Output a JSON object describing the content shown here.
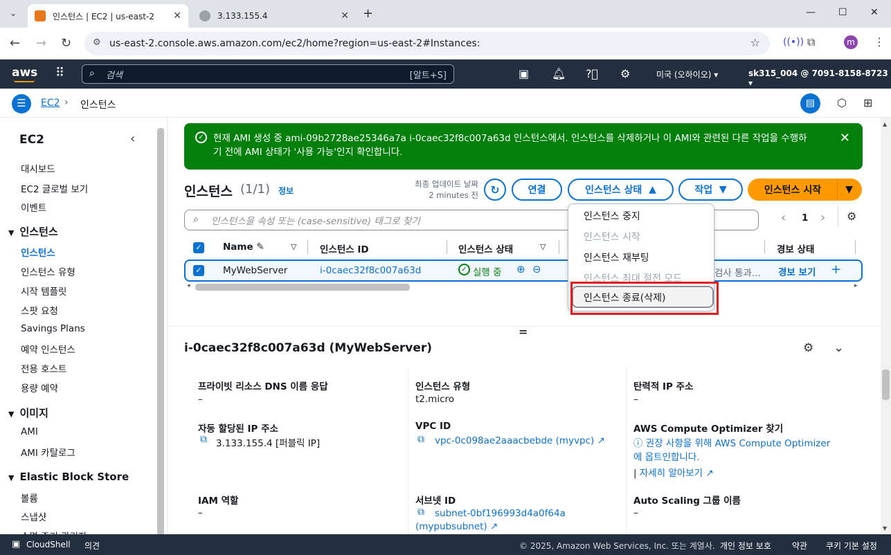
{
  "browser": {
    "tabs": [
      {
        "title": "인스턴스 | EC2 | us-east-2"
      },
      {
        "title": "3.133.155.4"
      }
    ],
    "url": "us-east-2.console.aws.amazon.com/ec2/home?region=us-east-2#Instances:",
    "profile_initial": "m"
  },
  "aws_nav": {
    "logo": "aws",
    "search_placeholder": "검색",
    "search_shortcut": "[알트+S]",
    "region": "미국 (오하이오)",
    "account": "sk315_004 @ 7091-8158-8723"
  },
  "breadcrumb": {
    "root": "EC2",
    "current": "인스턴스"
  },
  "sidebar": {
    "title": "EC2",
    "top_items": [
      "대시보드",
      "EC2 글로벌 보기",
      "이벤트"
    ],
    "sections": [
      {
        "label": "인스턴스",
        "items": [
          "인스턴스",
          "인스턴스 유형",
          "시작 템플릿",
          "스팟 요청",
          "Savings Plans",
          "예약 인스턴스",
          "전용 호스트",
          "용량 예약"
        ]
      },
      {
        "label": "이미지",
        "items": [
          "AMI",
          "AMI 카탈로그"
        ]
      },
      {
        "label": "Elastic Block Store",
        "items": [
          "볼륨",
          "스냅샷",
          "수명 주기 관리자"
        ]
      }
    ]
  },
  "flash": {
    "message_line1": "현재 AMI 생성 중 ami-09b2728ae25346a7a i-0caec32f8c007a63d 인스턴스에서. 인스턴스를 삭제하거나 이 AMI와 관련된 다른 작업을 수행하",
    "message_line2": "기 전에 AMI 상태가 '사용 가능'인지 확인합니다."
  },
  "instances": {
    "heading": "인스턴스",
    "count": "(1/1)",
    "info_link": "정보",
    "last_updated_label": "최종 업데이트 날짜",
    "last_updated_value": "2 minutes 전",
    "connect_button": "연결",
    "state_button": "인스턴스 상태",
    "actions_button": "작업",
    "launch_button": "인스턴스 시작",
    "filter_placeholder": "인스턴스을 속성 또는 (case-sensitive) 태그로 찾기",
    "page_number": "1",
    "columns": [
      "Name",
      "인스턴스 ID",
      "인스턴스 상태",
      "경보 상태"
    ],
    "row": {
      "name": "MyWebServer",
      "instance_id": "i-0caec32f8c007a63d",
      "state": "실행 중",
      "status_check": "검사 통과...",
      "alarm": "경보 보기"
    }
  },
  "state_menu": {
    "items": [
      {
        "label": "인스턴스 중지",
        "disabled": false
      },
      {
        "label": "인스턴스 시작",
        "disabled": true
      },
      {
        "label": "인스턴스 재부팅",
        "disabled": false
      },
      {
        "label": "인스턴스 최대 절전 모드",
        "disabled": true
      },
      {
        "label": "인스턴스 종료(삭제)",
        "disabled": false
      }
    ]
  },
  "details": {
    "title": "i-0caec32f8c007a63d (MyWebServer)",
    "fields": {
      "private_dns_label": "프라이빗 리소스 DNS 이름 응답",
      "private_dns_value": "–",
      "instance_type_label": "인스턴스 유형",
      "instance_type_value": "t2.micro",
      "elastic_ip_label": "탄력적 IP 주소",
      "elastic_ip_value": "–",
      "auto_ip_label": "자동 할당된 IP 주소",
      "auto_ip_value": "3.133.155.4 [퍼블릭 IP]",
      "vpc_label": "VPC ID",
      "vpc_value": "vpc-0c098ae2aaacbebde (myvpc)",
      "optimizer_label": "AWS Compute Optimizer 찾기",
      "optimizer_line1": "권장 사항을 위해 AWS Compute Optimizer",
      "optimizer_line2": "에 옵트인합니다.",
      "learn_more": "자세히 알아보기",
      "iam_label": "IAM 역할",
      "iam_value": "–",
      "subnet_label": "서브넷 ID",
      "subnet_line1": "subnet-0bf196993d4a0f64a",
      "subnet_line2": "(mypubsubnet)",
      "asg_label": "Auto Scaling 그룹 이름",
      "asg_value": "–"
    }
  },
  "footer": {
    "cloudshell": "CloudShell",
    "feedback": "의견",
    "copyright": "© 2025, Amazon Web Services, Inc. 또는 계열사.",
    "privacy": "개인 정보 보호",
    "terms": "약관",
    "cookies": "쿠키 기본 설정"
  },
  "colors": {
    "aws_nav": "#232f3e",
    "link": "#0972d3",
    "success": "#037f0c",
    "primary_button": "#ff9900",
    "highlight": "#e02020"
  }
}
